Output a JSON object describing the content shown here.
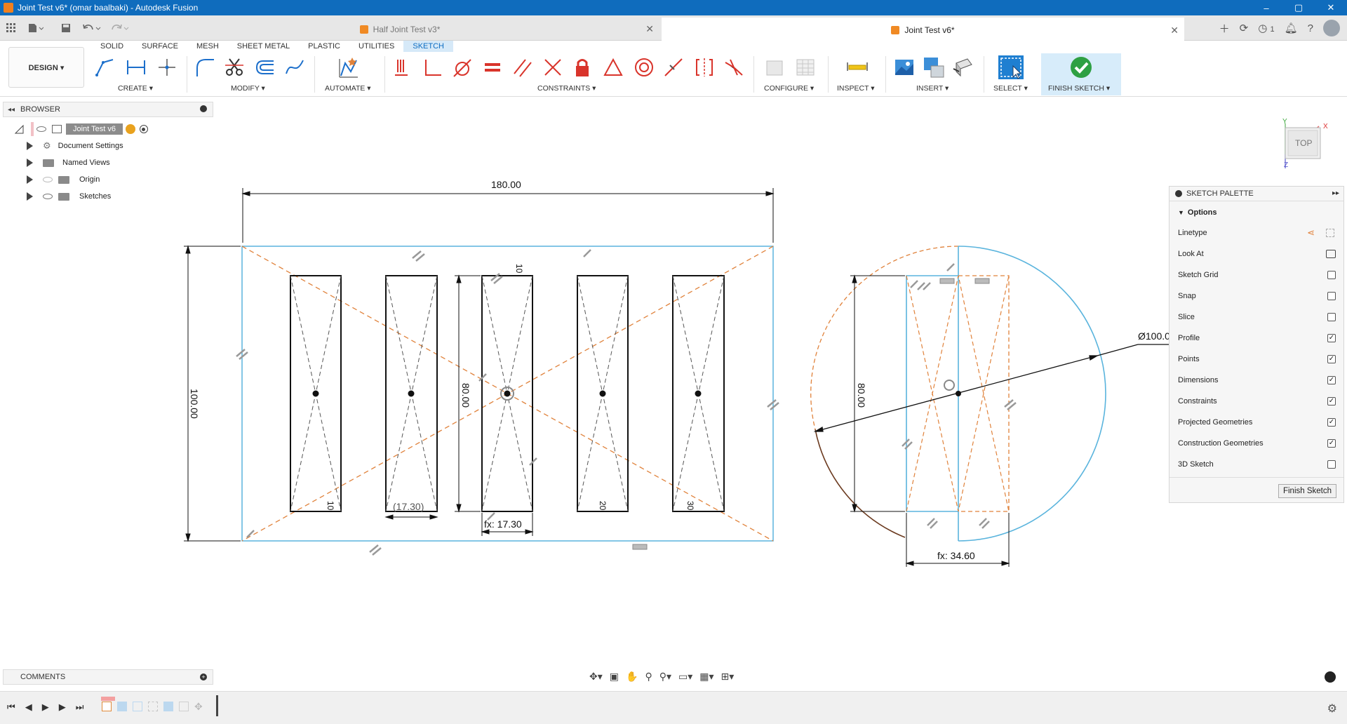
{
  "window": {
    "title": "Joint Test v6* (omar baalbaki) - Autodesk Fusion",
    "min": "–",
    "max": "▢",
    "close": "✕"
  },
  "doc_tabs": [
    {
      "label": "Half Joint Test v3*",
      "close": "✕"
    },
    {
      "label": "Joint Test v6*",
      "close": "✕"
    }
  ],
  "header_icons": {
    "jobs_count": "1"
  },
  "ribbon": {
    "tabs": [
      "SOLID",
      "SURFACE",
      "MESH",
      "SHEET METAL",
      "PLASTIC",
      "UTILITIES",
      "SKETCH"
    ],
    "active_tab": "SKETCH",
    "workspace": "DESIGN ▾",
    "groups": {
      "create": "CREATE ▾",
      "modify": "MODIFY ▾",
      "automate": "AUTOMATE ▾",
      "constraints": "CONSTRAINTS ▾",
      "configure": "CONFIGURE ▾",
      "inspect": "INSPECT ▾",
      "insert": "INSERT ▾",
      "select": "SELECT ▾",
      "finish": "FINISH SKETCH ▾"
    }
  },
  "browser": {
    "title": "BROWSER",
    "root": "Joint Test v6",
    "items": [
      "Document Settings",
      "Named Views",
      "Origin",
      "Sketches"
    ]
  },
  "comments": {
    "title": "COMMENTS"
  },
  "viewcube": {
    "face": "TOP",
    "x": "X",
    "y": "Y",
    "z": "Z"
  },
  "sketch": {
    "dim_width": "180.00",
    "dim_height": "100.00",
    "dim_slot_height": "80.00",
    "dim_slot_width_ref": "(17.30)",
    "dim_slot_width_fx": "fx: 17.30",
    "dim_circle_rect_height": "80.00",
    "dim_circle_width_fx": "fx: 34.60",
    "dim_diameter": "Ø100.0",
    "dim_small_a": "10",
    "dim_small_b": "10",
    "dim_small_c": "20",
    "dim_small_d": "30",
    "dim_small_e": "10"
  },
  "palette": {
    "title": "SKETCH PALETTE",
    "section": "Options",
    "linetype": "Linetype",
    "look_at": "Look At",
    "options": [
      {
        "label": "Sketch Grid",
        "checked": false
      },
      {
        "label": "Snap",
        "checked": false
      },
      {
        "label": "Slice",
        "checked": false
      },
      {
        "label": "Profile",
        "checked": true
      },
      {
        "label": "Points",
        "checked": true
      },
      {
        "label": "Dimensions",
        "checked": true
      },
      {
        "label": "Constraints",
        "checked": true
      },
      {
        "label": "Projected Geometries",
        "checked": true
      },
      {
        "label": "Construction Geometries",
        "checked": true
      },
      {
        "label": "3D Sketch",
        "checked": false
      }
    ],
    "finish_button": "Finish Sketch"
  },
  "colors": {
    "accent": "#0f6cbd",
    "sketch_blue": "#5ab4dd",
    "construction": "#e0823b",
    "finish_green": "#2ea043"
  }
}
